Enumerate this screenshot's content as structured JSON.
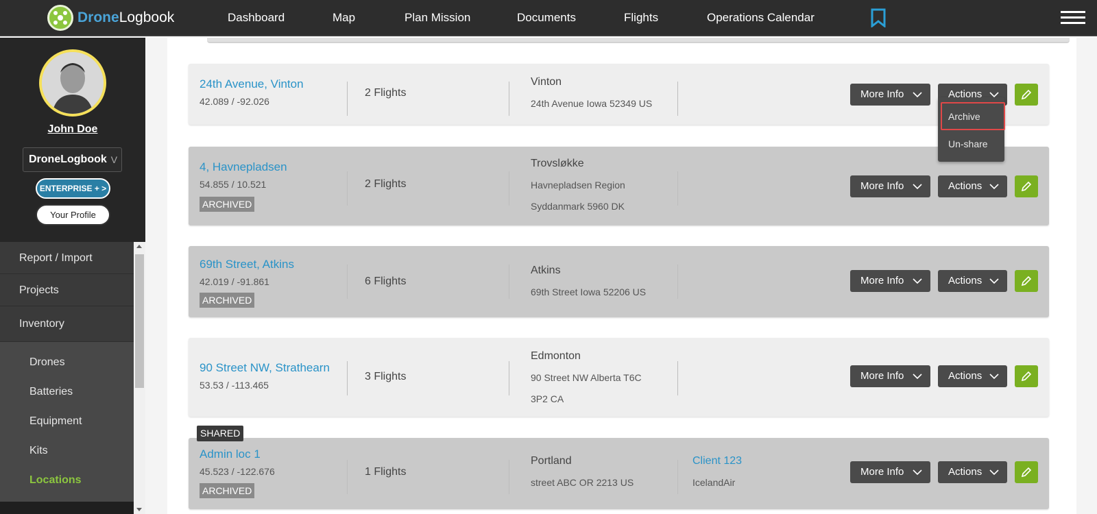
{
  "brand": {
    "name_part1": "Drone",
    "name_part2": "Logbook"
  },
  "nav": {
    "items": [
      "Dashboard",
      "Map",
      "Plan Mission",
      "Documents",
      "Flights",
      "Operations Calendar"
    ]
  },
  "icons": {
    "bookmark": "bookmark-icon",
    "menu": "hamburger-menu-icon",
    "edit": "pencil-icon",
    "chevron": "chevron-down-icon"
  },
  "colors": {
    "topbar": "#2d2d2d",
    "link_blue": "#2a93c8",
    "accent_green": "#8cc63f",
    "edit_green": "#7ab021",
    "enterprise_blue": "#2a7fa5"
  },
  "sidebar": {
    "user_name": "John Doe",
    "org": "DroneLogbook",
    "org_chevron": "V",
    "enterprise_label": "ENTERPRISE + >",
    "profile_label": "Your Profile",
    "menu": [
      "Report / Import",
      "Projects",
      "Inventory"
    ],
    "submenu": [
      "Drones",
      "Batteries",
      "Equipment",
      "Kits",
      "Locations"
    ],
    "active_submenu": "Locations"
  },
  "buttons": {
    "more_info": "More Info",
    "actions": "Actions"
  },
  "dropdown": {
    "items": [
      "Archive",
      "Un-share"
    ],
    "highlighted": "Archive"
  },
  "locations": [
    {
      "name": "24th Avenue, Vinton",
      "coords": "42.089 / -92.026",
      "flights": "2 Flights",
      "city": "Vinton",
      "address_lines": [
        "24th Avenue Iowa 52349 US"
      ],
      "archived": false
    },
    {
      "name": "4, Havnepladsen",
      "coords": "54.855 / 10.521",
      "flights": "2 Flights",
      "city": "Trovsløkke",
      "address_lines": [
        "Havnepladsen Region",
        "Syddanmark 5960 DK"
      ],
      "archived": true,
      "archived_label": "ARCHIVED"
    },
    {
      "name": "69th Street, Atkins",
      "coords": "42.019 / -91.861",
      "flights": "6 Flights",
      "city": "Atkins",
      "address_lines": [
        "69th Street Iowa 52206 US"
      ],
      "archived": true,
      "archived_label": "ARCHIVED"
    },
    {
      "name": "90 Street NW, Strathearn",
      "coords": "53.53 / -113.465",
      "flights": "3 Flights",
      "city": "Edmonton",
      "address_lines": [
        "90 Street NW Alberta T6C",
        "3P2 CA"
      ],
      "archived": false
    },
    {
      "name": "Admin loc 1",
      "coords": "45.523 / -122.676",
      "flights": "1 Flights",
      "city": "Portland",
      "address_lines": [
        "street ABC OR 2213 US"
      ],
      "archived": true,
      "archived_label": "ARCHIVED",
      "shared_label": "SHARED",
      "client": "Client 123",
      "client_sub": "IcelandAir"
    }
  ]
}
